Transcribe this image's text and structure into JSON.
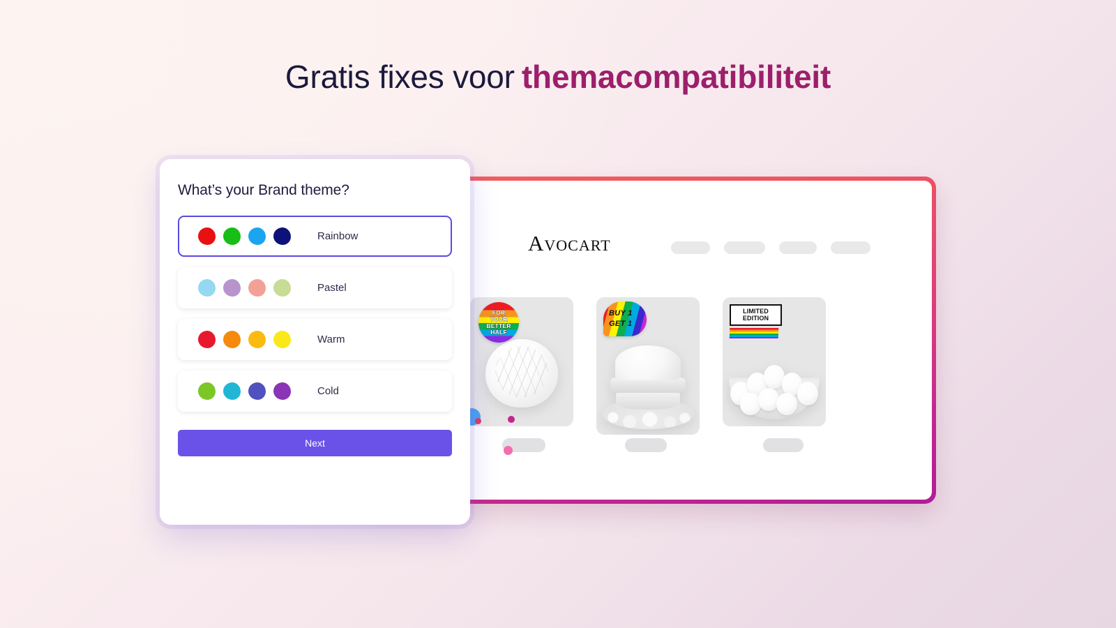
{
  "heading": {
    "part1": "Gratis fixes voor",
    "part2": "themacompatibiliteit",
    "color1": "#1b1a3c",
    "color2": "#9c1f6b"
  },
  "picker": {
    "title": "What’s your Brand theme?",
    "next_label": "Next",
    "accent_color": "#6a52e8",
    "selected_option": "Rainbow",
    "options": [
      {
        "label": "Rainbow",
        "selected": true,
        "colors": [
          "#e81010",
          "#16be16",
          "#1ba5f0",
          "#0d1278"
        ]
      },
      {
        "label": "Pastel",
        "selected": false,
        "colors": [
          "#95d8f2",
          "#b894cc",
          "#f2a196",
          "#c7dc95"
        ]
      },
      {
        "label": "Warm",
        "selected": false,
        "colors": [
          "#e8192c",
          "#f58a0c",
          "#fbba10",
          "#fbe81a"
        ]
      },
      {
        "label": "Cold",
        "selected": false,
        "colors": [
          "#7cc626",
          "#22b6d6",
          "#5051be",
          "#8b34b5"
        ]
      }
    ]
  },
  "storefront": {
    "logo": "Avocart",
    "border_gradient": [
      "#f2615f",
      "#b01e96"
    ],
    "nav_placeholder_count": 4,
    "products": [
      {
        "name": "bread-loaf",
        "badge_type": "circle-rainbow-sticker",
        "badge_lines": [
          "FOR",
          "YOUR",
          "BETTER",
          "HALF"
        ]
      },
      {
        "name": "burger",
        "badge_type": "rainbow-speech-bubble",
        "badge_lines": [
          "BUY 1",
          "GET 1"
        ]
      },
      {
        "name": "eggs-basket",
        "badge_type": "limited-edition-label",
        "badge_lines": [
          "LIMITED",
          "EDITION"
        ]
      }
    ]
  },
  "confetti": {
    "colors": [
      "#f0d95c",
      "#3ec6bd",
      "#3aa855",
      "#2f7a46",
      "#4aa3f0",
      "#f26fae",
      "#d93c6a",
      "#c2268e"
    ]
  }
}
